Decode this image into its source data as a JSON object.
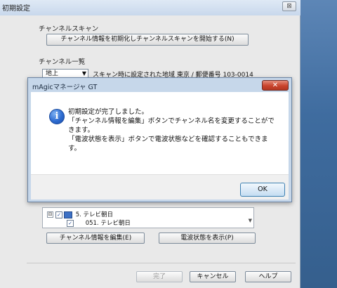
{
  "window": {
    "title": "初期設定",
    "close_label": "⊠"
  },
  "channel_scan": {
    "group_label": "チャンネルスキャン",
    "init_scan_button": "チャンネル情報を初期化しチャンネルスキャンを開始する(N)"
  },
  "channel_list": {
    "group_label": "チャンネル一覧",
    "combo_value": "地上",
    "region_text": "スキャン時に設定された地域 東京 / 郵便番号 103-0014",
    "items": [
      {
        "label": "5. テレビ朝日",
        "level": 0,
        "checked": true,
        "expander": "⊟"
      },
      {
        "label": "051. テレビ朝日",
        "level": 1,
        "checked": true
      }
    ],
    "edit_button": "チャンネル情報を編集(E)",
    "signal_button": "電波状態を表示(P)"
  },
  "footer": {
    "finish_button": "完了",
    "cancel_button": "キャンセル",
    "help_button": "ヘルプ"
  },
  "dialog": {
    "title": "mAgicマネージャ GT",
    "close_label": "✕",
    "message_lines": [
      "初期設定が完了しました。",
      "「チャンネル情報を編集」ボタンでチャンネル名を変更することがで",
      "きます。",
      "「電波状態を表示」ボタンで電波状態などを確認することもできま",
      "す。"
    ],
    "ok_button": "OK"
  }
}
